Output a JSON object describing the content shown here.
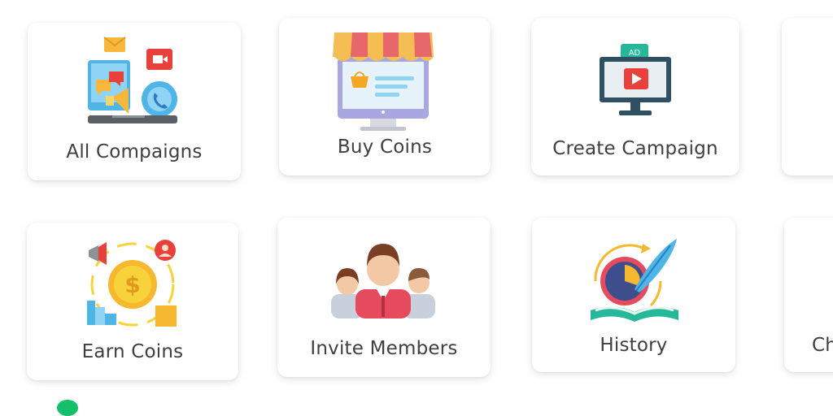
{
  "cards": [
    {
      "label": "All Compaigns",
      "icon": "campaigns-icon"
    },
    {
      "label": "Buy Coins",
      "icon": "shop-icon"
    },
    {
      "label": "Create Campaign",
      "icon": "ad-monitor-icon"
    },
    {
      "label": "",
      "icon": ""
    },
    {
      "label": "Earn Coins",
      "icon": "gold-coin-icon"
    },
    {
      "label": "Invite Members",
      "icon": "team-icon"
    },
    {
      "label": "History",
      "icon": "history-icon"
    },
    {
      "label": "Ch",
      "icon": ""
    }
  ],
  "colors": {
    "card_bg": "#ffffff",
    "label_text": "#3f3f3f",
    "accent_green": "#16c06a"
  }
}
